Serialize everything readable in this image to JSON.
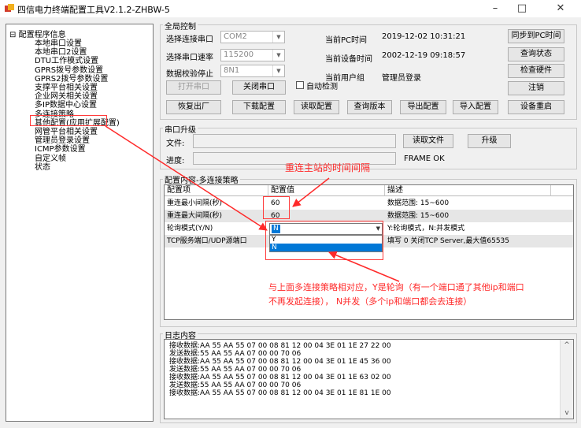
{
  "window": {
    "title": "四信电力终端配置工具V2.1.2-ZHBW-5",
    "minimize": "–",
    "maximize": "□",
    "close": "✕",
    "icon": "app-icon"
  },
  "tree": {
    "root_toggle": "⊟",
    "root": "配置程序信息",
    "items": [
      "本地串口设置",
      "本地串口2设置",
      "DTU工作模式设置",
      "GPRS拨号参数设置",
      "GPRS2拨号参数设置",
      "支撑平台相关设置",
      "企业网关相关设置",
      "多IP数据中心设置",
      "多连接策略",
      "其他配置(应用扩展配置)",
      "网管平台相关设置",
      "管理员登录设置",
      "ICMP参数设置",
      "自定义帧",
      "状态"
    ]
  },
  "global": {
    "title": "全局控制",
    "port_label": "选择连接串口",
    "port_value": "COM2",
    "baud_label": "选择串口速率",
    "baud_value": "115200",
    "parity_label": "数据校验停止",
    "parity_value": "8N1",
    "pc_time_label": "当前PC时间",
    "pc_time_value": "2019-12-02 10:31:21",
    "dev_time_label": "当前设备时间",
    "dev_time_value": "2002-12-19 09:18:57",
    "user_group_label": "当前用户组",
    "user_group_value": "管理员登录",
    "open_port": "打开串口",
    "close_port": "关闭串口",
    "auto_detect": "自动检测",
    "sync_pc": "同步到PC时间",
    "query_status": "查询状态",
    "check_hw": "检查硬件",
    "logout": "注销",
    "factory_reset": "恢复出厂",
    "download_config": "下载配置",
    "read_config": "读取配置",
    "query_version": "查询版本",
    "export_config": "导出配置",
    "import_config": "导入配置",
    "reboot": "设备重启"
  },
  "upgrade": {
    "title": "串口升级",
    "file_label": "文件:",
    "progress_label": "进度:",
    "read_file": "读取文件",
    "upgrade_btn": "升级",
    "status": "FRAME OK"
  },
  "config": {
    "title": "配置内容-多连接策略",
    "columns": [
      "配置项",
      "配置值",
      "描述"
    ],
    "rows": [
      {
        "name": "重连最小间隔(秒)",
        "value": "60",
        "desc": "数据范围: 15~600"
      },
      {
        "name": "重连最大间隔(秒)",
        "value": "60",
        "desc": "数据范围: 15~600"
      },
      {
        "name": "轮询模式(Y/N)",
        "value": "N",
        "desc": "Y:轮询模式，N:并发模式"
      },
      {
        "name": "TCP服务端口/UDP源端口",
        "value": "",
        "desc": "填写 0 关闭TCP Server,最大值65535"
      }
    ],
    "dropdown_options": [
      "Y",
      "N"
    ]
  },
  "annotations": {
    "reconnect_note": "重连主站的时间间隔",
    "strategy_note_line1": "与上面多连接策略相对应，Y是轮询（有一个端口通了其他ip和端口",
    "strategy_note_line2": "不再发起连接），  N并发（多个ip和端口都会去连接）"
  },
  "log": {
    "title": "日志内容",
    "lines": [
      "接收数据:AA 55 AA 55 07 00 08 81 12 00 04 3E 01 1E 27 22 00",
      "发送数据:55 AA 55 AA 07 00 00 70 06",
      "接收数据:AA 55 AA 55 07 00 08 81 12 00 04 3E 01 1E 45 36 00",
      "发送数据:55 AA 55 AA 07 00 00 70 06",
      "接收数据:AA 55 AA 55 07 00 08 81 12 00 04 3E 01 1E 63 02 00",
      "发送数据:55 AA 55 AA 07 00 00 70 06",
      "接收数据:AA 55 AA 55 07 00 08 81 12 00 04 3E 01 1E 81 1E 00"
    ],
    "scroll_up": "^",
    "scroll_down": "v"
  },
  "colors": {
    "annotation_red": "#ff2a2a",
    "selection_blue": "#0078d7",
    "highlight_row": "#e6e6e6"
  }
}
